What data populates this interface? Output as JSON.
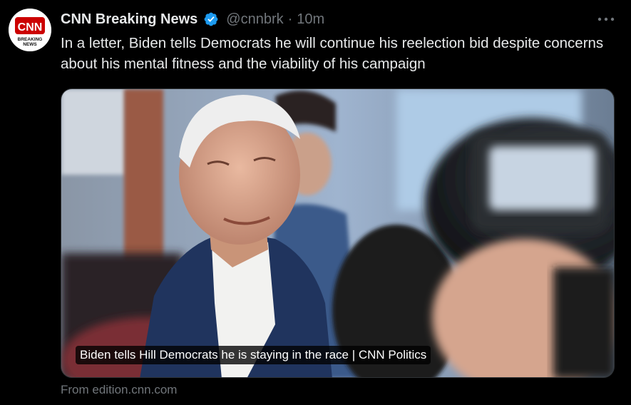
{
  "author": {
    "display_name": "CNN Breaking News",
    "handle": "@cnnbrk",
    "separator": "·",
    "time": "10m",
    "avatar_logo_text": "CNN",
    "avatar_sub_line1": "BREAKING",
    "avatar_sub_line2": "NEWS"
  },
  "tweet": {
    "text": "In a letter, Biden tells Democrats he will continue his reelection bid despite concerns about his mental fitness and the viability of his campaign"
  },
  "card": {
    "caption": "Biden tells Hill Democrats he is staying in the race | CNN Politics",
    "source": "From edition.cnn.com"
  },
  "icons": {
    "verified": "verified-badge-icon",
    "more": "more-options-icon"
  },
  "colors": {
    "background": "#000000",
    "text_primary": "#e7e9ea",
    "text_secondary": "#71767b",
    "verified_blue": "#1d9bf0",
    "cnn_red": "#cc0000"
  }
}
